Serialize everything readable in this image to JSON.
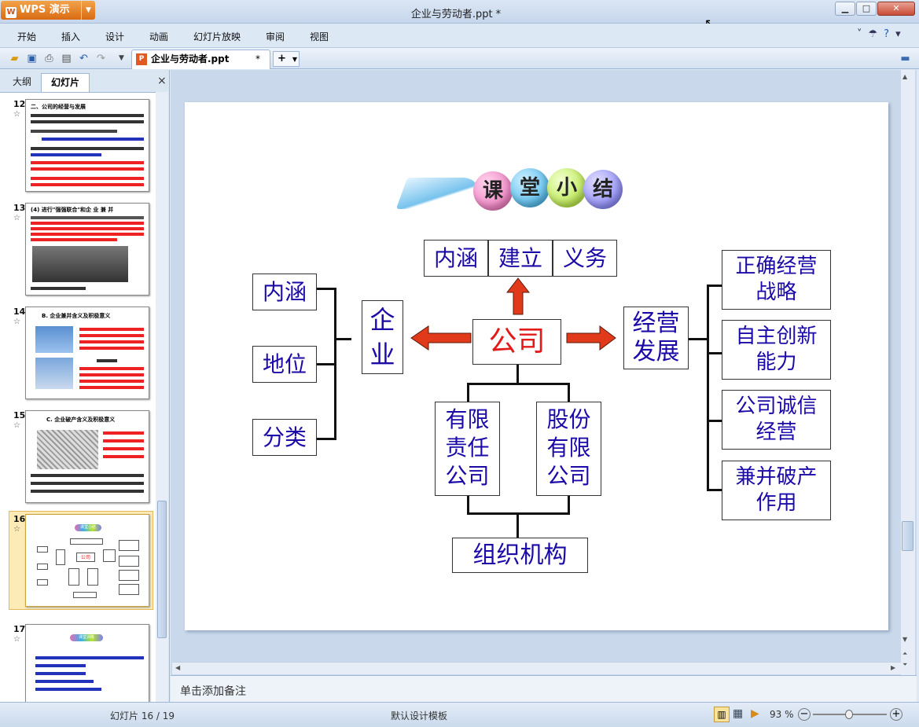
{
  "app": {
    "name": "WPS 演示",
    "window_title": "企业与劳动者.ppt *",
    "window_controls": [
      "minimize-icon",
      "maximize-icon",
      "close-icon"
    ]
  },
  "menu": {
    "items": [
      "开始",
      "插入",
      "设计",
      "动画",
      "幻灯片放映",
      "审阅",
      "视图"
    ]
  },
  "toolbar": {
    "icons": [
      "open-icon",
      "save-icon",
      "print-icon",
      "print-preview-icon",
      "undo-icon",
      "redo-icon",
      "more-icon"
    ],
    "doc_tab": "企业与劳动者.ppt",
    "doc_tab_close": "*",
    "new_tab": "+"
  },
  "left_panel": {
    "tabs": [
      "大纲",
      "幻灯片"
    ],
    "close": "×",
    "thumbnails": [
      {
        "num": "12",
        "title": "二、公司的经营与发展"
      },
      {
        "num": "13",
        "title": "(4) 进行\"强强联合\"和企 业 兼 并"
      },
      {
        "num": "14",
        "title": "B. 企业兼并含义及积极意义"
      },
      {
        "num": "15",
        "title": "C. 企业破产含义及积极意义"
      },
      {
        "num": "16",
        "title": "课堂小结"
      },
      {
        "num": "17",
        "title": "课堂训练"
      }
    ],
    "star": "☆"
  },
  "slide": {
    "banner": [
      "课",
      "堂",
      "小",
      "结"
    ],
    "top_boxes": [
      "内涵",
      "建立",
      "义务"
    ],
    "left_boxes": [
      "内涵",
      "地位",
      "分类"
    ],
    "enterprise": "企\n业",
    "company": "公司",
    "development": "经营\n发展",
    "right_boxes": [
      "正确经营\n战略",
      "自主创新\n能力",
      "公司诚信\n经营",
      "兼并破产\n作用"
    ],
    "limited": "有限\n责任\n公司",
    "joint_stock": "股份\n有限\n公司",
    "org": "组织机构"
  },
  "notes": {
    "placeholder": "单击添加备注"
  },
  "status": {
    "slide_count": "幻灯片 16 / 19",
    "template": "默认设计模板",
    "zoom": "93 %",
    "zoom_level": 0.93
  }
}
